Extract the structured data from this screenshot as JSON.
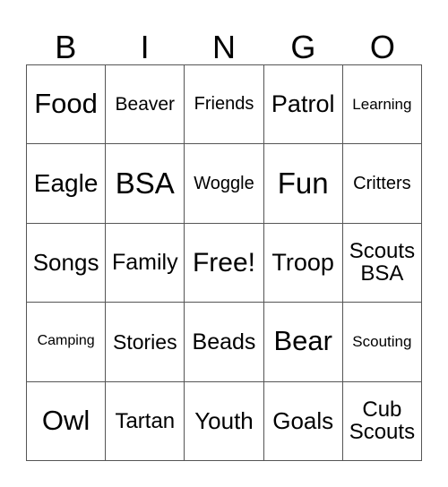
{
  "card": {
    "header_letters": [
      "B",
      "I",
      "N",
      "G",
      "O"
    ],
    "background_color": "#ffffff",
    "border_color": "#555555",
    "text_color": "#000000",
    "rows": [
      [
        {
          "text": "Food",
          "font_size": "31px"
        },
        {
          "text": "Beaver",
          "font_size": "21px"
        },
        {
          "text": "Friends",
          "font_size": "20px"
        },
        {
          "text": "Patrol",
          "font_size": "27px"
        },
        {
          "text": "Learning",
          "font_size": "17px"
        }
      ],
      [
        {
          "text": "Eagle",
          "font_size": "28px"
        },
        {
          "text": "BSA",
          "font_size": "33px"
        },
        {
          "text": "Woggle",
          "font_size": "20px"
        },
        {
          "text": "Fun",
          "font_size": "33px"
        },
        {
          "text": "Critters",
          "font_size": "20px"
        }
      ],
      [
        {
          "text": "Songs",
          "font_size": "26px"
        },
        {
          "text": "Family",
          "font_size": "25px"
        },
        {
          "text": "Free!",
          "font_size": "30px"
        },
        {
          "text": "Troop",
          "font_size": "27px"
        },
        {
          "text": "Scouts\nBSA",
          "font_size": "24px"
        }
      ],
      [
        {
          "text": "Camping",
          "font_size": "16px"
        },
        {
          "text": "Stories",
          "font_size": "23px"
        },
        {
          "text": "Beads",
          "font_size": "25px"
        },
        {
          "text": "Bear",
          "font_size": "31px"
        },
        {
          "text": "Scouting",
          "font_size": "17px"
        }
      ],
      [
        {
          "text": "Owl",
          "font_size": "31px"
        },
        {
          "text": "Tartan",
          "font_size": "24px"
        },
        {
          "text": "Youth",
          "font_size": "26px"
        },
        {
          "text": "Goals",
          "font_size": "26px"
        },
        {
          "text": "Cub\nScouts",
          "font_size": "24px"
        }
      ]
    ]
  }
}
